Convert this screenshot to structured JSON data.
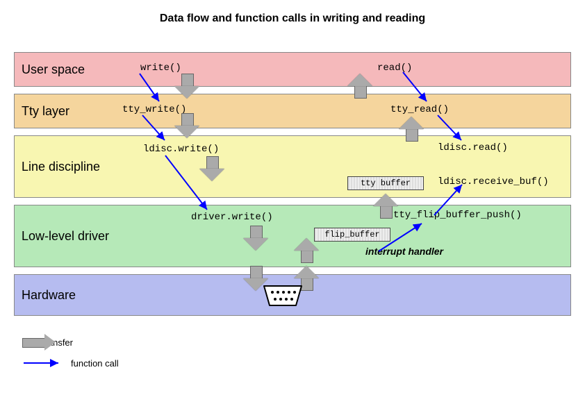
{
  "title": "Data flow and function calls in writing and reading",
  "layers": {
    "user": "User space",
    "tty": "Tty layer",
    "ldisc": "Line discipline",
    "driver": "Low-level driver",
    "hw": "Hardware"
  },
  "calls": {
    "write": "write()",
    "tty_write": "tty_write()",
    "ldisc_write": "ldisc.write()",
    "driver_write": "driver.write()",
    "read": "read()",
    "tty_read": "tty_read()",
    "ldisc_read": "ldisc.read()",
    "ldisc_recv": "ldisc.receive_buf()",
    "tty_flip": "tty_flip_buffer_push()",
    "ihandler": "interrupt handler"
  },
  "buffers": {
    "tty_buffer": "tty buffer",
    "flip_buffer": "flip_buffer"
  },
  "legend": {
    "data_transfer": "data transfer",
    "function_call": "function call"
  },
  "colors": {
    "user": "#f5b9bb",
    "tty": "#f5d59d",
    "ldisc": "#f8f6b1",
    "driver": "#b6e9b8",
    "hw": "#b6bcf0",
    "arrow_gray": "#aaaaaa",
    "arrow_blue": "#0000ff"
  }
}
